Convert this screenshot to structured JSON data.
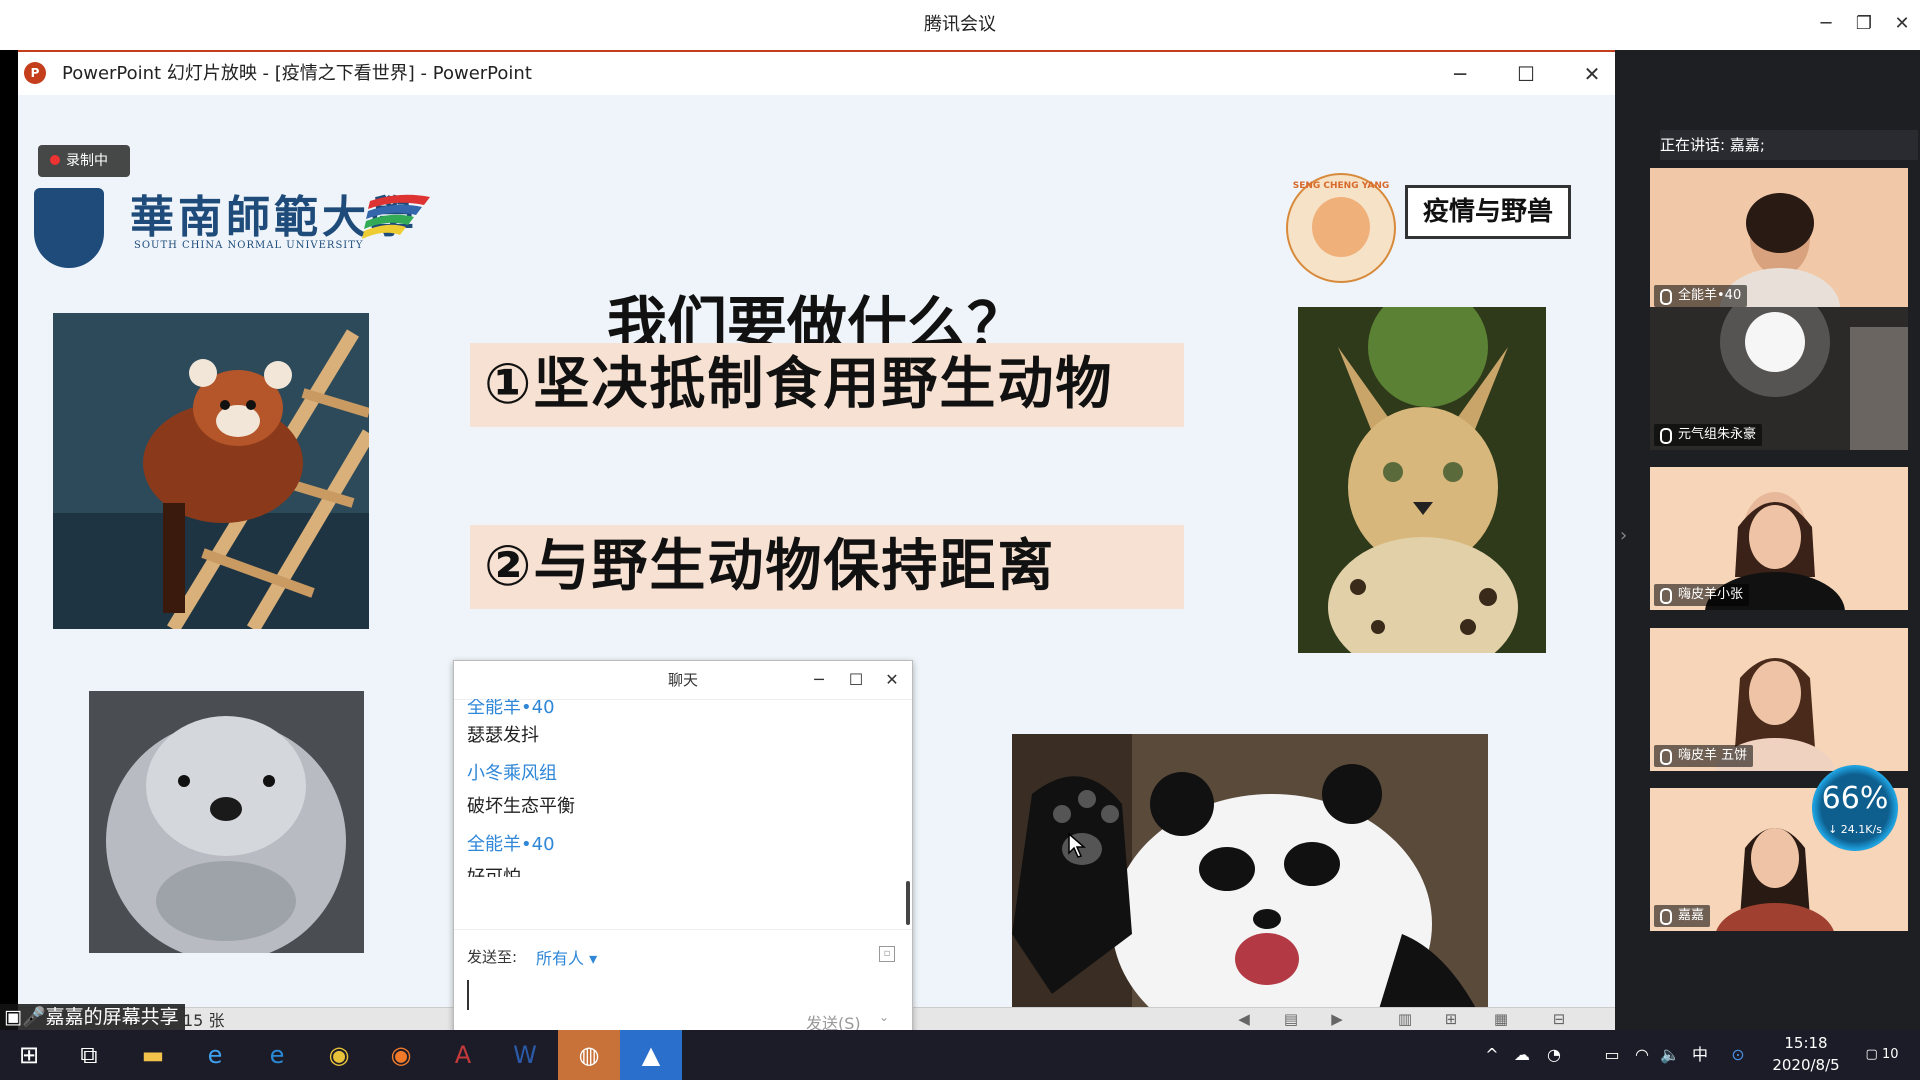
{
  "meeting_app": {
    "title": "腾讯会议",
    "window_controls": {
      "minimize": "─",
      "restore": "❐",
      "close": "✕"
    }
  },
  "powerpoint": {
    "title": "PowerPoint 幻灯片放映 - [疫情之下看世界] - PowerPoint",
    "logo_letter": "P",
    "window_controls": {
      "minimize": "─",
      "maximize": "☐",
      "close": "✕"
    },
    "status_slide_count": "15 张"
  },
  "slide": {
    "recording_badge": "录制中",
    "university_name_cn": "華南師範大學",
    "university_name_en": "SOUTH CHINA NORMAL UNIVERSITY",
    "sheep_logo_text": "SENG CHENG YANG",
    "topic_box": "疫情与野兽",
    "heading": "我们要做什么？",
    "point_1": "①坚决抵制食用野生动物",
    "point_2": "②与野生动物保持距离"
  },
  "chat": {
    "title": "聊天",
    "window_controls": {
      "minimize": "─",
      "maximize": "☐",
      "close": "✕"
    },
    "messages": [
      {
        "sender": "全能羊•40",
        "text": "瑟瑟发抖"
      },
      {
        "sender": "小冬乘风组",
        "text": "破坏生态平衡"
      },
      {
        "sender": "全能羊•40",
        "text": "好可怕"
      }
    ],
    "send_to_label": "发送至:",
    "send_to_value": "所有人 ▾",
    "send_button": "发送(S)",
    "send_dropdown": "⌄"
  },
  "share_label": "嘉嘉的屏幕共享",
  "side_panel": {
    "speaking": "正在讲话: 嘉嘉;",
    "participants": [
      {
        "name": "全能羊•40"
      },
      {
        "name": "元气组朱永豪"
      },
      {
        "name": "嗨皮羊小张"
      },
      {
        "name": "嗨皮羊 五饼"
      },
      {
        "name": "嘉嘉"
      }
    ],
    "speed_percent": "66%",
    "speed_rate": "↓ 24.1K/s"
  },
  "taskbar": {
    "time": "15:18",
    "date": "2020/8/5",
    "ime": "中",
    "notification_count": "10"
  }
}
